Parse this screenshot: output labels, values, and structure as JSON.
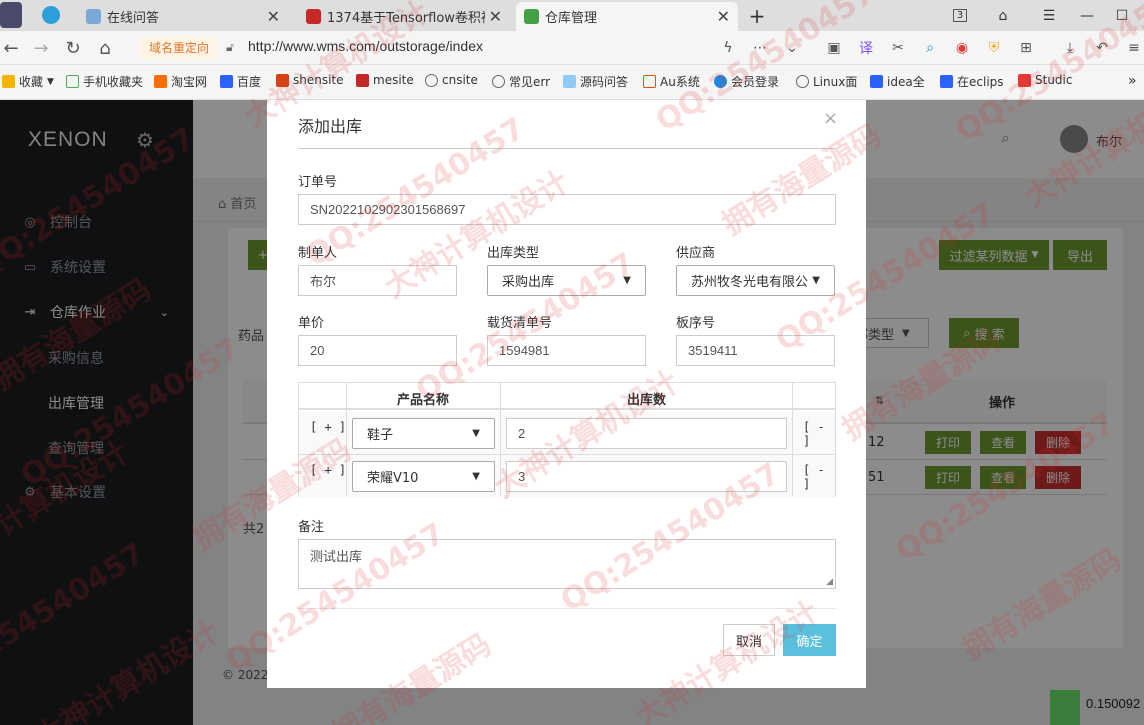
{
  "browser": {
    "tabs": [
      {
        "title": "在线问答"
      },
      {
        "title": "1374基于Tensorflow卷积神经"
      },
      {
        "title": "仓库管理"
      }
    ],
    "tab_counter": "3",
    "redirect_badge": "域名重定向",
    "url": "http://www.wms.com/outstorage/index",
    "bookmarks": [
      "收藏",
      "手机收藏夹",
      "淘宝网",
      "百度",
      "shensite",
      "mesite",
      "cnsite",
      "常见err",
      "源码问答",
      "Au系统",
      "会员登录",
      "Linux面",
      "idea全",
      "在eclips",
      "Studic"
    ]
  },
  "app": {
    "logo": "XENON",
    "sidebar": {
      "items": [
        {
          "label": "控制台"
        },
        {
          "label": "系统设置"
        },
        {
          "label": "仓库作业"
        },
        {
          "label": "基本设置"
        }
      ],
      "sub_items": [
        "采购信息",
        "出库管理",
        "查询管理"
      ]
    },
    "header": {
      "user": "布尔"
    },
    "breadcrumb": "首页",
    "toolbar": {
      "filter_button": "过滤某列数据",
      "export_button": "导出",
      "search_button": "搜 索",
      "type_select": "部类型",
      "drug_label": "药品"
    },
    "table": {
      "action_header": "操作",
      "rows": [
        {
          "tail": "12",
          "print": "打印",
          "view": "查看",
          "delete": "删除"
        },
        {
          "tail": "51",
          "print": "打印",
          "view": "查看",
          "delete": "删除"
        }
      ]
    },
    "footer_count": "共2",
    "footer_copyright": "© 2022"
  },
  "modal": {
    "title": "添加出库",
    "order_no": {
      "label": "订单号",
      "value": "SN2022102902301568697"
    },
    "maker": {
      "label": "制单人",
      "value": "布尔"
    },
    "out_type": {
      "label": "出库类型",
      "value": "采购出库"
    },
    "supplier": {
      "label": "供应商",
      "value": "苏州牧冬光电有限公"
    },
    "unit_price": {
      "label": "单价",
      "value": "20"
    },
    "cargo_no": {
      "label": "载货清单号",
      "value": "1594981"
    },
    "pallet_no": {
      "label": "板序号",
      "value": "3519411"
    },
    "product_table": {
      "header_name": "产品名称",
      "header_qty": "出库数",
      "add": "[ + ]",
      "remove": "[ - ]",
      "rows": [
        {
          "product": "鞋子",
          "qty": "2"
        },
        {
          "product": "荣耀V10",
          "qty": "3"
        }
      ]
    },
    "remark": {
      "label": "备注",
      "value": "测试出库"
    },
    "cancel": "取消",
    "confirm": "确定"
  },
  "watermark": {
    "qq": "QQ:254540457",
    "a": "拥有海量源码",
    "b": "大神计算机设计"
  },
  "tray_value": "0.150092"
}
